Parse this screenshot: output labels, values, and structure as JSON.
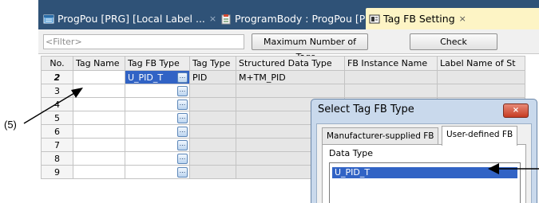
{
  "tabs": [
    {
      "label": "ProgPou [PRG] [Local Label ...",
      "close": "×"
    },
    {
      "label": "ProgramBody : ProgPou [PR...",
      "close": "×"
    },
    {
      "label": "Tag FB Setting",
      "close": "×"
    }
  ],
  "toolbar": {
    "filter_placeholder": "<Filter>",
    "max_tags_label": "Maximum Number of Tags...",
    "check_label": "Check"
  },
  "grid": {
    "headers": [
      "No.",
      "Tag Name",
      "Tag FB Type",
      "Tag Type",
      "Structured Data Type",
      "FB Instance Name",
      "Label Name of St"
    ],
    "rows": [
      {
        "no": "2",
        "tag_name": "",
        "fb_type": "U_PID_T",
        "tag_type": "PID",
        "struct": "M+TM_PID",
        "instance": "",
        "label": ""
      },
      {
        "no": "3",
        "tag_name": "",
        "fb_type": "",
        "tag_type": "",
        "struct": "",
        "instance": "",
        "label": ""
      },
      {
        "no": "4",
        "tag_name": "",
        "fb_type": "",
        "tag_type": "",
        "struct": "",
        "instance": "",
        "label": ""
      },
      {
        "no": "5",
        "tag_name": "",
        "fb_type": "",
        "tag_type": "",
        "struct": "",
        "instance": "",
        "label": ""
      },
      {
        "no": "6",
        "tag_name": "",
        "fb_type": "",
        "tag_type": "",
        "struct": "",
        "instance": "",
        "label": ""
      },
      {
        "no": "7",
        "tag_name": "",
        "fb_type": "",
        "tag_type": "",
        "struct": "",
        "instance": "",
        "label": ""
      },
      {
        "no": "8",
        "tag_name": "",
        "fb_type": "",
        "tag_type": "",
        "struct": "",
        "instance": "",
        "label": ""
      },
      {
        "no": "9",
        "tag_name": "",
        "fb_type": "",
        "tag_type": "",
        "struct": "",
        "instance": "",
        "label": ""
      }
    ],
    "ellipsis": "..."
  },
  "dialog": {
    "title": "Select Tag FB Type",
    "close": "×",
    "tabs": [
      "Manufacturer-supplied FB",
      "User-defined FB"
    ],
    "data_type_label": "Data Type",
    "items": [
      "U_PID_T"
    ]
  },
  "annotations": {
    "callout": "(5)"
  },
  "colors": {
    "tabbar": "#2f5277",
    "active_tab": "#fdf4c5",
    "selection": "#3163c5"
  }
}
